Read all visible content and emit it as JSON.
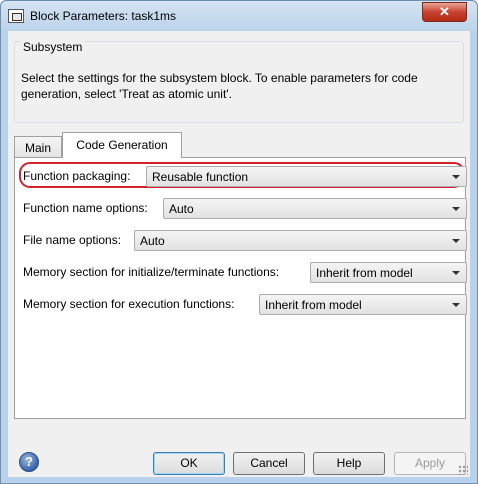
{
  "window": {
    "title": "Block Parameters: task1ms",
    "close_glyph": "✕"
  },
  "subsystem": {
    "title": "Subsystem",
    "description": "Select the settings for the subsystem block. To enable parameters for code generation, select 'Treat as atomic unit'."
  },
  "tabs": [
    {
      "label": "Main",
      "selected": false
    },
    {
      "label": "Code Generation",
      "selected": true
    }
  ],
  "fields": {
    "function_packaging": {
      "label": "Function packaging:",
      "value": "Reusable function"
    },
    "function_name_options": {
      "label": "Function name options:",
      "value": "Auto"
    },
    "file_name_options": {
      "label": "File name options:",
      "value": "Auto"
    },
    "memory_init": {
      "label": "Memory section for initialize/terminate functions:",
      "value": "Inherit from model"
    },
    "memory_exec": {
      "label": "Memory section for execution functions:",
      "value": "Inherit from model"
    }
  },
  "buttons": {
    "ok": "OK",
    "cancel": "Cancel",
    "help": "Help",
    "apply": "Apply"
  },
  "help_icon_glyph": "?",
  "colors": {
    "highlight_ring": "#d4202c",
    "close_button": "#c7432f"
  }
}
